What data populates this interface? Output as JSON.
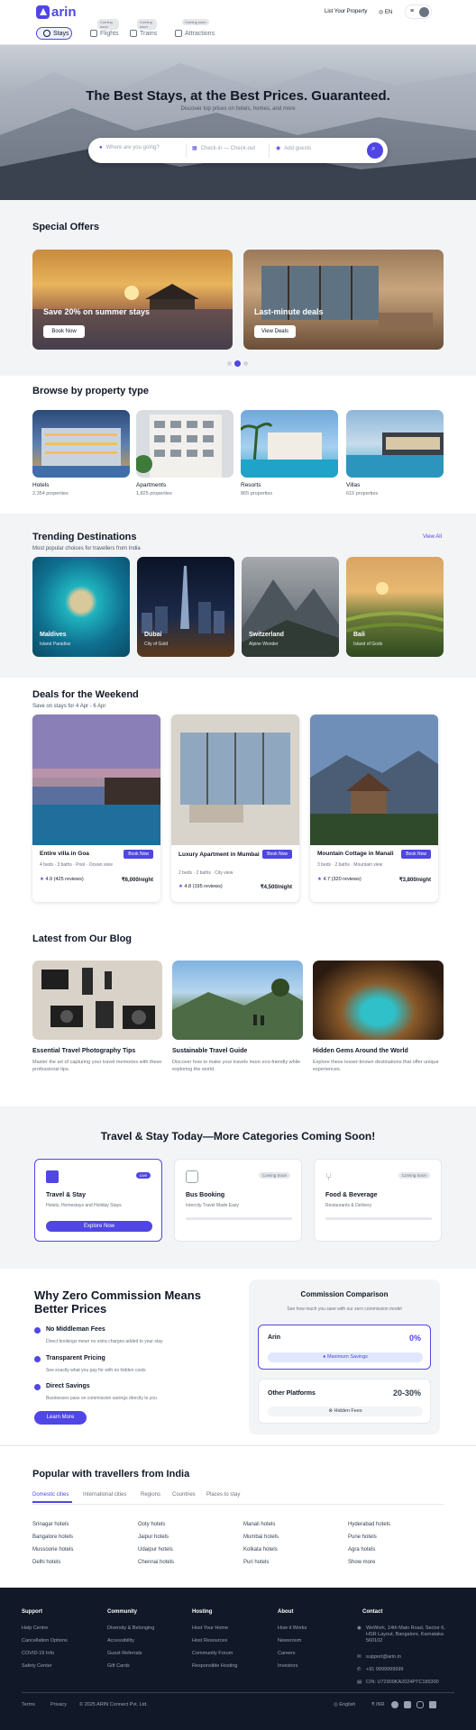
{
  "header": {
    "logo_text": "arin",
    "tabs": [
      {
        "label": "Stays",
        "badge": ""
      },
      {
        "label": "Flights",
        "badge": "Coming soon"
      },
      {
        "label": "Trains",
        "badge": "Coming soon"
      },
      {
        "label": "Attractions",
        "badge": "Coming soon"
      }
    ],
    "list_property": "List Your Property",
    "language": "EN",
    "colors": {
      "accent": "#4f46e5"
    }
  },
  "hero": {
    "title": "The Best Stays, at the Best Prices. Guaranteed.",
    "subtitle": "Discover top prices on hotels, homes, and more",
    "search_destination": "Where are you going?",
    "search_dates": "Check-in — Check-out",
    "search_guests": "Add guests"
  },
  "special_offers": {
    "title": "Special Offers",
    "cards": [
      {
        "title": "Save 20% on summer stays",
        "button": "Book Now"
      },
      {
        "title": "Last-minute deals",
        "button": "View Deals"
      }
    ]
  },
  "property_types": {
    "title": "Browse by property type",
    "items": [
      {
        "label": "Hotels",
        "count": "2,354 properties"
      },
      {
        "label": "Apartments",
        "count": "1,825 properties"
      },
      {
        "label": "Resorts",
        "count": "865 properties"
      },
      {
        "label": "Villas",
        "count": "615 properties"
      }
    ]
  },
  "trending": {
    "title": "Trending Destinations",
    "subtitle": "Most popular choices for travellers from India",
    "view_all": "View All",
    "items": [
      {
        "name": "Maldives",
        "sub": "Island Paradise"
      },
      {
        "name": "Dubai",
        "sub": "City of Gold"
      },
      {
        "name": "Switzerland",
        "sub": "Alpine Wonder"
      },
      {
        "name": "Bali",
        "sub": "Island of Gods"
      }
    ]
  },
  "deals": {
    "title": "Deals for the Weekend",
    "subtitle": "Save on stays for 4 Apr - 6 Apr",
    "cards": [
      {
        "title": "Entire villa in Goa",
        "meta": "4 beds · 3 baths · Pool · Ocean view",
        "button": "Book Now",
        "rating": "4.9 (425 reviews)",
        "price": "₹6,000/night"
      },
      {
        "title": "Luxury Apartment in Mumbai",
        "meta": "2 beds · 2 baths · City view",
        "button": "Book Now",
        "rating": "4.8 (195 reviews)",
        "price": "₹4,500/night"
      },
      {
        "title": "Mountain Cottage in Manali",
        "meta": "3 beds · 2 baths · Mountain view",
        "button": "Book Now",
        "rating": "4.7 (320 reviews)",
        "price": "₹3,800/night"
      }
    ]
  },
  "blog": {
    "title": "Latest from Our Blog",
    "posts": [
      {
        "title": "Essential Travel Photography Tips",
        "desc": "Master the art of capturing your travel memories with these professional tips."
      },
      {
        "title": "Sustainable Travel Guide",
        "desc": "Discover how to make your travels more eco-friendly while exploring the world."
      },
      {
        "title": "Hidden Gems Around the World",
        "desc": "Explore these lesser-known destinations that offer unique experiences."
      }
    ]
  },
  "categories": {
    "title": "Travel & Stay Today—More Categories Coming Soon!",
    "cards": [
      {
        "title": "Travel & Stay",
        "desc": "Hotels, Homestays and Holiday Stays",
        "badge": "Live",
        "button": "Explore Now"
      },
      {
        "title": "Bus Booking",
        "desc": "Intercity Travel Made Easy",
        "badge": "Coming Soon"
      },
      {
        "title": "Food & Beverage",
        "desc": "Restaurants & Delivery",
        "badge": "Coming Soon"
      }
    ]
  },
  "why": {
    "title": "Why Zero Commission Means Better Prices",
    "features": [
      {
        "title": "No Middleman Fees",
        "desc": "Direct bookings mean no extra charges added to your stay"
      },
      {
        "title": "Transparent Pricing",
        "desc": "See exactly what you pay for with no hidden costs"
      },
      {
        "title": "Direct Savings",
        "desc": "Businesses pass on commission savings directly to you"
      }
    ],
    "learn_more": "Learn More"
  },
  "comparison": {
    "title": "Commission Comparison",
    "subtitle": "See how much you save with our zero commission model",
    "arin_label": "Arin",
    "arin_value": "0%",
    "arin_pill": "Maximum Savings",
    "other_label": "Other Platforms",
    "other_value": "20-30%",
    "other_pill": "Hidden Fees"
  },
  "popular": {
    "title": "Popular with travellers from India",
    "tabs": [
      "Domestic cities",
      "International cities",
      "Regions",
      "Countries",
      "Places to stay"
    ],
    "columns": [
      [
        "Srinagar hotels",
        "Bangalore hotels",
        "Mussoorie hotels",
        "Delhi hotels"
      ],
      [
        "Ooty hotels",
        "Jaipur hotels",
        "Udaipur hotels",
        "Chennai hotels"
      ],
      [
        "Manali hotels",
        "Mumbai hotels",
        "Kolkata hotels",
        "Puri hotels"
      ],
      [
        "Hyderabad hotels",
        "Pune hotels",
        "Agra hotels",
        "Show more"
      ]
    ]
  },
  "footer": {
    "columns": [
      {
        "heading": "Support",
        "links": [
          "Help Centre",
          "Cancellation Options",
          "COVID-19 Info",
          "Safety Center"
        ]
      },
      {
        "heading": "Community",
        "links": [
          "Diversity & Belonging",
          "Accessibility",
          "Guest Referrals",
          "Gift Cards"
        ]
      },
      {
        "heading": "Hosting",
        "links": [
          "Host Your Home",
          "Host Resources",
          "Community Forum",
          "Responsible Hosting"
        ]
      },
      {
        "heading": "About",
        "links": [
          "How it Works",
          "Newsroom",
          "Careers",
          "Investors"
        ]
      }
    ],
    "contact_heading": "Contact",
    "contact": [
      "WeWork, 14th Main Road, Sector 6, HSR Layout, Bangalore, Karnataka 560102",
      "support@arin.in",
      "+91 9999999999",
      "CIN: U72900KA2024PTC185300"
    ],
    "bottom_links": [
      "Terms",
      "Privacy"
    ],
    "copyright": "© 2025 ARIN Connect Pvt. Ltd.",
    "language": "English",
    "currency": "₹ INR"
  }
}
